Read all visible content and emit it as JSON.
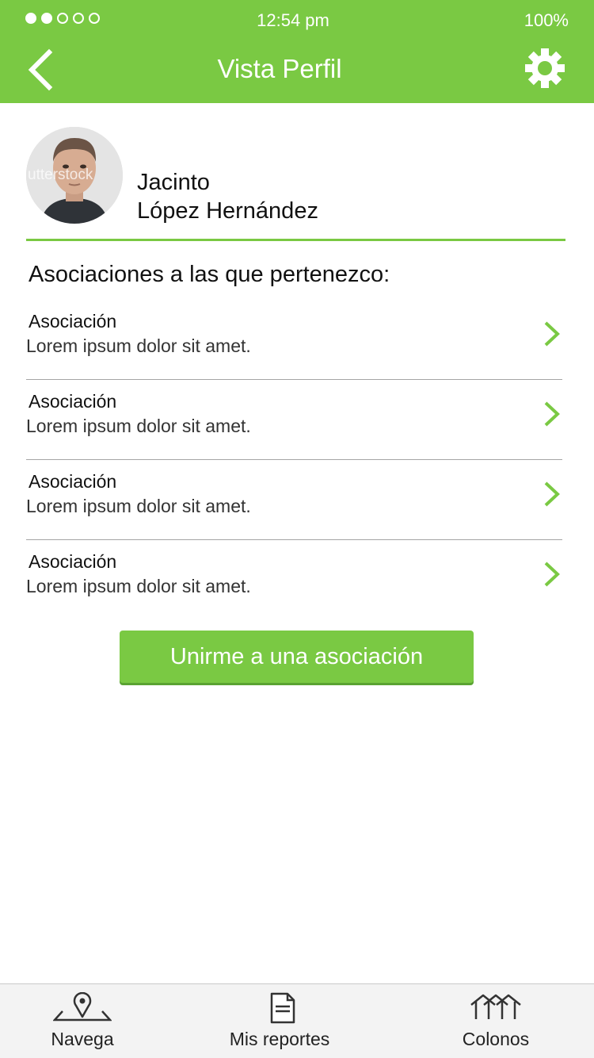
{
  "status_bar": {
    "signal_dots": [
      true,
      true,
      false,
      false,
      false
    ],
    "time": "12:54 pm",
    "battery": "100%"
  },
  "header": {
    "title": "Vista Perfil",
    "back_icon": "chevron-left-icon",
    "settings_icon": "gear-icon"
  },
  "profile": {
    "first_name": "Jacinto",
    "last_name": "López Hernández",
    "avatar_watermark": "utterstock"
  },
  "associations": {
    "heading": "Asociaciones a las que pertenezco:",
    "items": [
      {
        "title": "Asociación",
        "description": "Lorem ipsum dolor sit amet."
      },
      {
        "title": "Asociación",
        "description": "Lorem ipsum dolor sit amet."
      },
      {
        "title": "Asociación",
        "description": "Lorem ipsum dolor sit amet."
      },
      {
        "title": "Asociación",
        "description": "Lorem ipsum dolor sit amet."
      }
    ]
  },
  "join_button": {
    "label": "Unirme a una asociación"
  },
  "bottom_nav": {
    "items": [
      {
        "label": "Navega",
        "icon": "map-pin-icon"
      },
      {
        "label": "Mis reportes",
        "icon": "document-icon"
      },
      {
        "label": "Colonos",
        "icon": "houses-icon"
      }
    ]
  },
  "colors": {
    "accent": "#7ac943",
    "divider": "#a5a5a5",
    "nav_background": "#f3f3f3"
  }
}
